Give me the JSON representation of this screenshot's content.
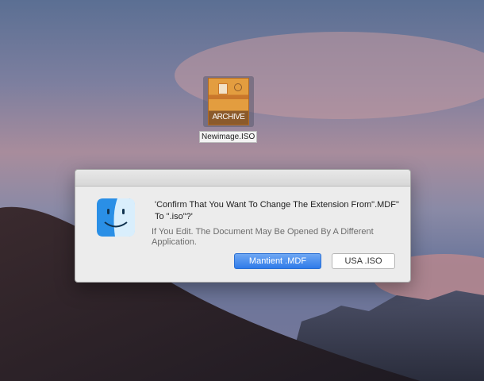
{
  "desktop": {
    "file_icon_label": "ARCHIVE",
    "file_name": "Newimage.ISO"
  },
  "dialog": {
    "title_text": "'Confirm That You Want To Change The Extension From\".MDF\" To \".iso\"?'",
    "body_text": "If You Edit. The Document May Be Opened By A Different Application.",
    "primary_button": "Mantient .MDF",
    "secondary_button": "USA .ISO"
  },
  "colors": {
    "primary_button": "#2f7be9",
    "dialog_bg": "#ececec"
  },
  "icons": [
    "archive-icon",
    "finder-icon"
  ]
}
